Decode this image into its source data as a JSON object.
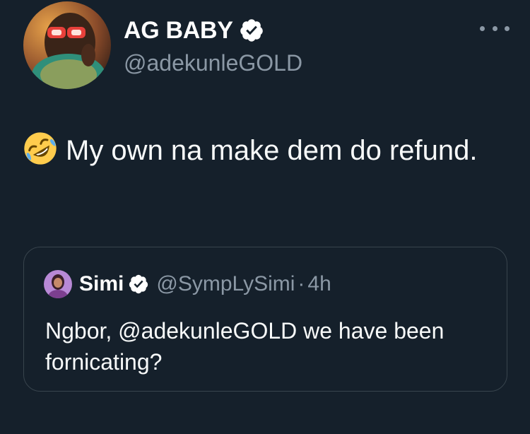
{
  "author": {
    "display_name": "AG BABY",
    "handle": "@adekunleGOLD",
    "verified": true
  },
  "tweet": {
    "emoji": "rolling-on-the-floor-laughing-emoji",
    "text": "My own na make dem do refund."
  },
  "quoted_tweet": {
    "display_name": "Simi",
    "handle": "@SympLySimi",
    "separator": "·",
    "time": "4h",
    "text": "Ngbor, @adekunleGOLD we have been fornicating?"
  },
  "colors": {
    "background": "#15202b",
    "secondary_text": "#8b98a5",
    "verified_badge": "#ffffff",
    "quote_border": "#38444d"
  }
}
